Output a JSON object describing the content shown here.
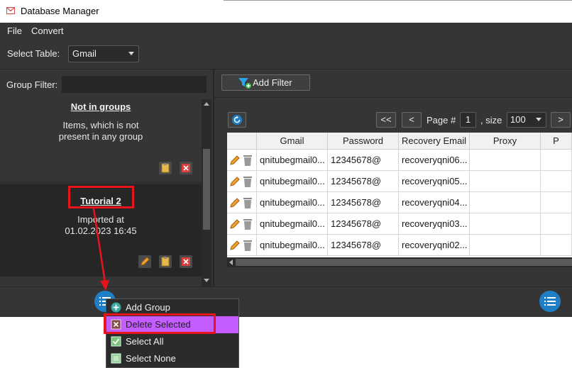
{
  "window": {
    "title": "Database Manager"
  },
  "menu": {
    "file": "File",
    "convert": "Convert"
  },
  "table_select": {
    "label": "Select Table:",
    "value": "Gmail"
  },
  "group_filter": {
    "label": "Group Filter:",
    "value": ""
  },
  "groups": [
    {
      "title": "Not in groups",
      "desc_line1": "Items, which is not",
      "desc_line2": "present in any group"
    },
    {
      "title": "Tutorial 2",
      "desc_line1": "Imported at",
      "desc_line2": "01.02.2023 16:45"
    }
  ],
  "filter": {
    "add_label": "Add Filter"
  },
  "pager": {
    "first": "<<",
    "prev": "<",
    "page_label": "Page #",
    "page_value": "1",
    "size_label": ", size",
    "size_value": "100",
    "next": ">"
  },
  "grid": {
    "columns": [
      "Gmail",
      "Password",
      "Recovery Email",
      "Proxy",
      "P"
    ],
    "rows": [
      [
        "qnitubegmail0...",
        "12345678@",
        "recoveryqni06...",
        "",
        ""
      ],
      [
        "qnitubegmail0...",
        "12345678@",
        "recoveryqni05...",
        "",
        ""
      ],
      [
        "qnitubegmail0...",
        "12345678@",
        "recoveryqni04...",
        "",
        ""
      ],
      [
        "qnitubegmail0...",
        "12345678@",
        "recoveryqni03...",
        "",
        ""
      ],
      [
        "qnitubegmail0...",
        "12345678@",
        "recoveryqni02...",
        "",
        ""
      ]
    ]
  },
  "context_menu": {
    "items": [
      {
        "label": "Add Group",
        "icon": "plus-circle-icon"
      },
      {
        "label": "Delete Selected",
        "icon": "delete-x-icon"
      },
      {
        "label": "Select All",
        "icon": "checkbox-checked-icon"
      },
      {
        "label": "Select None",
        "icon": "checkbox-empty-icon"
      }
    ]
  },
  "colors": {
    "accent_blue": "#1f7fc6",
    "highlight": "#c45cff",
    "annotation_red": "#e8141c",
    "panel_bg": "#353535"
  }
}
